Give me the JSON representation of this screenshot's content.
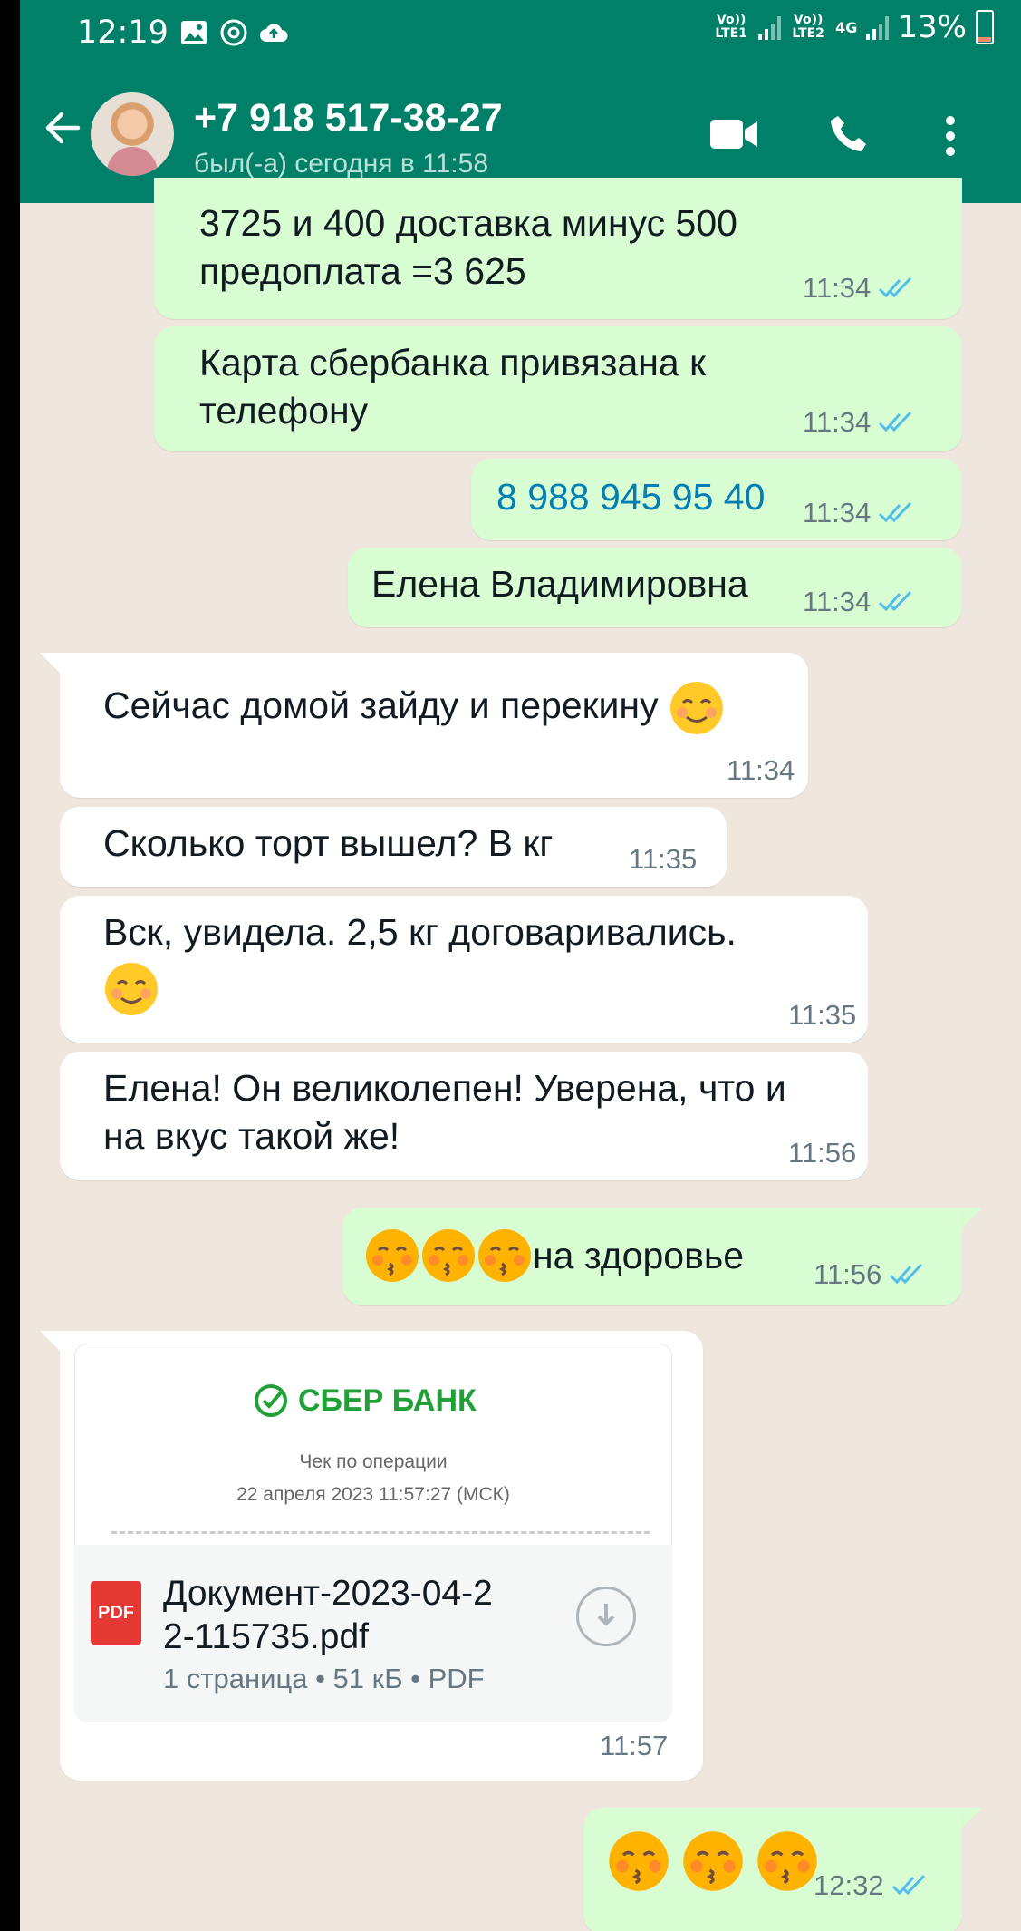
{
  "status_bar": {
    "time": "12:19",
    "icons": [
      "gallery-icon",
      "sync-icon",
      "cloud-upload-icon"
    ],
    "sim1": "Vo)) LTE1",
    "sim2": "Vo)) LTE2",
    "network": "4G",
    "battery": "13%"
  },
  "header": {
    "title": "+7 918 517-38-27",
    "subtitle": "был(-а) сегодня в 11:58",
    "icons": [
      "back-arrow-icon",
      "video-call-icon",
      "phone-call-icon",
      "more-vert-icon"
    ]
  },
  "messages": {
    "m1": {
      "text": "3725 и 400 доставка минус 500\nпредоплата =3 625",
      "time": "11:34"
    },
    "m2": {
      "text": "Карта сбербанка привязана к\nтелефону",
      "time": "11:34"
    },
    "m3": {
      "text": "8 988 945 95 40",
      "time": "11:34"
    },
    "m4": {
      "text": "Елена Владимировна",
      "time": "11:34"
    },
    "m5": {
      "text": "Сейчас домой зайду и перекину",
      "time": "11:34"
    },
    "m6": {
      "text": "Сколько торт вышел? В кг",
      "time": "11:35"
    },
    "m7": {
      "text": "Вск, увидела. 2,5 кг договаривались.",
      "time": "11:35"
    },
    "m8": {
      "text": "Елена! Он великолепен! Уверена, что и\nна вкус такой же!",
      "time": "11:56"
    },
    "m9": {
      "text": "на здоровье",
      "time": "11:56"
    },
    "m10": {
      "preview_brand": "СБЕР БАНК",
      "preview_line1": "Чек по операции",
      "preview_line2": "22 апреля 2023 11:57:27 (МСК)",
      "file_type_badge": "PDF",
      "file_name": "Документ-2023-04-2\n2-115735.pdf",
      "file_details": "1 страница • 51 кБ • PDF",
      "time": "11:57"
    },
    "m11": {
      "time": "12:32"
    }
  },
  "colors": {
    "header": "#008069",
    "chat_bg": "#EFE7DE",
    "outgoing": "#D9FDD3",
    "incoming": "#FFFFFF",
    "read_tick": "#53BDEB",
    "link": "#027EB5"
  }
}
